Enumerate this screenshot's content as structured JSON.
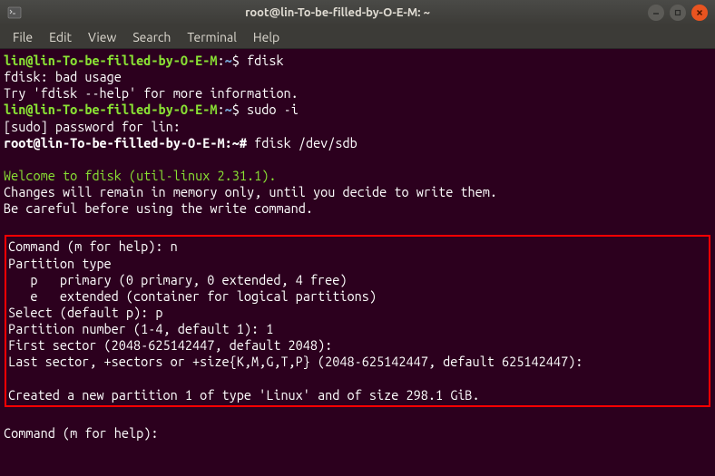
{
  "window": {
    "title": "root@lin-To-be-filled-by-O-E-M: ~"
  },
  "menubar": {
    "items": [
      "File",
      "Edit",
      "View",
      "Search",
      "Terminal",
      "Help"
    ]
  },
  "prompts": {
    "user_host": "lin@lin-To-be-filled-by-O-E-M",
    "user_path": "~",
    "user_symbol": "$",
    "root_host": "root@lin-To-be-filled-by-O-E-M",
    "root_path": "~",
    "root_symbol": "#"
  },
  "lines": {
    "cmd1": " fdisk",
    "err1": "fdisk: bad usage",
    "err2": "Try 'fdisk --help' for more information.",
    "cmd2": " sudo -i",
    "sudo_prompt": "[sudo] password for lin:",
    "cmd3": " fdisk /dev/sdb",
    "blank": " ",
    "welcome": "Welcome to fdisk (util-linux 2.31.1).",
    "info1": "Changes will remain in memory only, until you decide to write them.",
    "info2": "Be careful before using the write command.",
    "box_cmd": "Command (m for help): n",
    "box_pt": "Partition type",
    "box_p": "   p   primary (0 primary, 0 extended, 4 free)",
    "box_e": "   e   extended (container for logical partitions)",
    "box_sel": "Select (default p): p",
    "box_pn": "Partition number (1-4, default 1): 1",
    "box_fs": "First sector (2048-625142447, default 2048):",
    "box_ls": "Last sector, +sectors or +size{K,M,G,T,P} (2048-625142447, default 625142447):",
    "box_created": "Created a new partition 1 of type 'Linux' and of size 298.1 GiB.",
    "final_cmd": "Command (m for help): "
  }
}
